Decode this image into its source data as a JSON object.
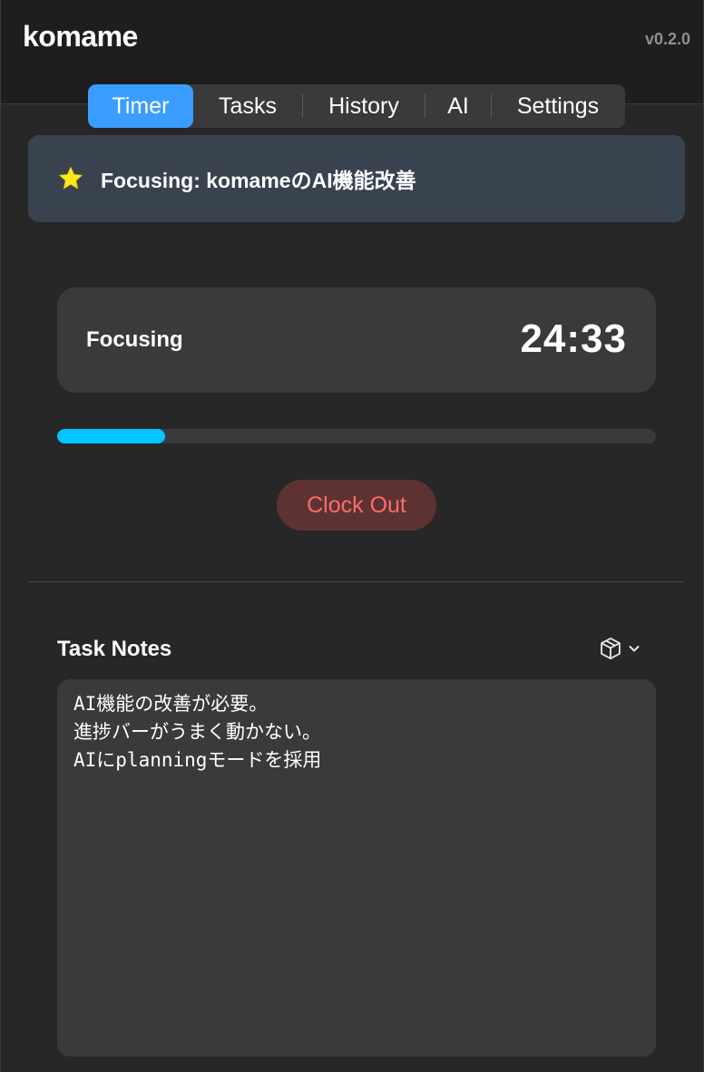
{
  "app": {
    "name": "komame",
    "version": "v0.2.0"
  },
  "tabs": [
    {
      "label": "Timer",
      "active": true
    },
    {
      "label": "Tasks",
      "active": false
    },
    {
      "label": "History",
      "active": false
    },
    {
      "label": "AI",
      "active": false
    },
    {
      "label": "Settings",
      "active": false
    }
  ],
  "focus_banner": {
    "icon": "star-icon",
    "text": "Focusing: komameのAI機能改善"
  },
  "timer": {
    "state_label": "Focusing",
    "time": "24:33",
    "progress_percent": 18
  },
  "actions": {
    "clock_out_label": "Clock Out"
  },
  "notes": {
    "title": "Task Notes",
    "menu_icon": "cube-icon",
    "lines": [
      "AI機能の改善が必要。",
      "進捗バーがうまく動かない。",
      "AIにplanningモードを採用"
    ]
  },
  "colors": {
    "accent": "#3b9dff",
    "progress": "#00c5ff",
    "danger_text": "#ff6b6b",
    "danger_bg": "#5e3233",
    "star": "#ffe81a",
    "banner_bg": "#394350"
  }
}
